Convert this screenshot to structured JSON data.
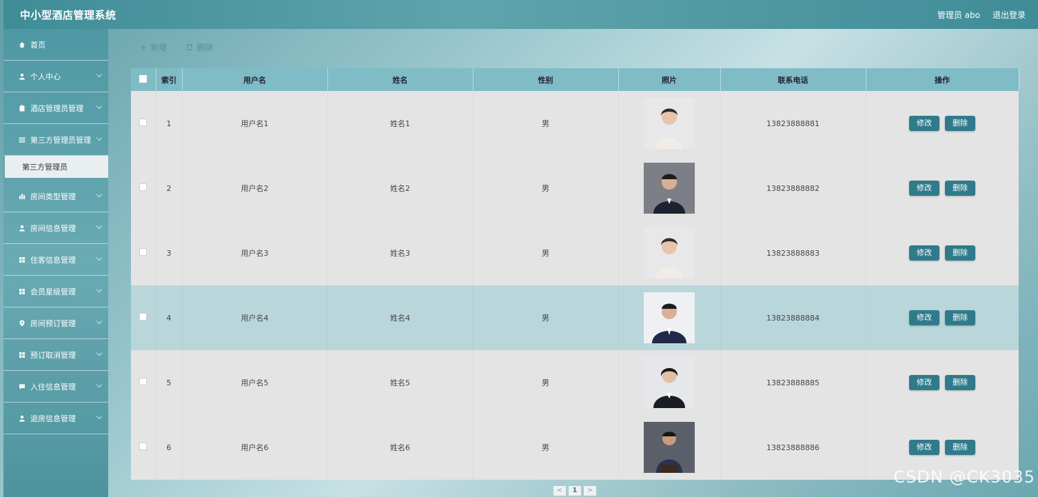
{
  "header": {
    "title": "中小型酒店管理系统",
    "user": "管理员 abo",
    "logout": "退出登录"
  },
  "sidebar": {
    "items": [
      {
        "label": "首页",
        "icon": "home-icon"
      },
      {
        "label": "个人中心",
        "icon": "user-icon"
      },
      {
        "label": "酒店管理员管理",
        "icon": "clipboard-icon"
      },
      {
        "label": "第三方管理员管理",
        "icon": "list-icon"
      },
      {
        "label": "房间类型管理",
        "icon": "bar-chart-icon"
      },
      {
        "label": "房间信息管理",
        "icon": "user-icon"
      },
      {
        "label": "住客信息管理",
        "icon": "grid-icon"
      },
      {
        "label": "会员星级管理",
        "icon": "grid-icon"
      },
      {
        "label": "房间预订管理",
        "icon": "location-pin-icon"
      },
      {
        "label": "预订取消管理",
        "icon": "grid-icon"
      },
      {
        "label": "入住信息管理",
        "icon": "comment-icon"
      },
      {
        "label": "退房信息管理",
        "icon": "user-icon"
      }
    ],
    "active_sub": "第三方管理员"
  },
  "toolbar": {
    "add_label": "新增",
    "delete_label": "删除"
  },
  "table": {
    "columns": [
      "索引",
      "用户名",
      "姓名",
      "性别",
      "照片",
      "联系电话",
      "操作"
    ],
    "rows": [
      {
        "index": "1",
        "username": "用户名1",
        "name": "姓名1",
        "gender": "男",
        "phone": "13823888881",
        "photo": "female-portrait"
      },
      {
        "index": "2",
        "username": "用户名2",
        "name": "姓名2",
        "gender": "男",
        "phone": "13823888882",
        "photo": "male-portrait"
      },
      {
        "index": "3",
        "username": "用户名3",
        "name": "姓名3",
        "gender": "男",
        "phone": "13823888883",
        "photo": "female-portrait"
      },
      {
        "index": "4",
        "username": "用户名4",
        "name": "姓名4",
        "gender": "男",
        "phone": "13823888884",
        "photo": "male-portrait"
      },
      {
        "index": "5",
        "username": "用户名5",
        "name": "姓名5",
        "gender": "男",
        "phone": "13823888885",
        "photo": "female-portrait"
      },
      {
        "index": "6",
        "username": "用户名6",
        "name": "姓名6",
        "gender": "男",
        "phone": "13823888886",
        "photo": "male-portrait"
      }
    ],
    "edit_label": "修改",
    "delete_label": "删除"
  },
  "pagination": {
    "prev": "<",
    "current": "1",
    "next": ">"
  },
  "watermark": "CSDN @CK3035",
  "colors": {
    "accent": "#2f7b8b",
    "header_bg": "#7fbcc6",
    "row_highlight": "#b9d6da"
  }
}
